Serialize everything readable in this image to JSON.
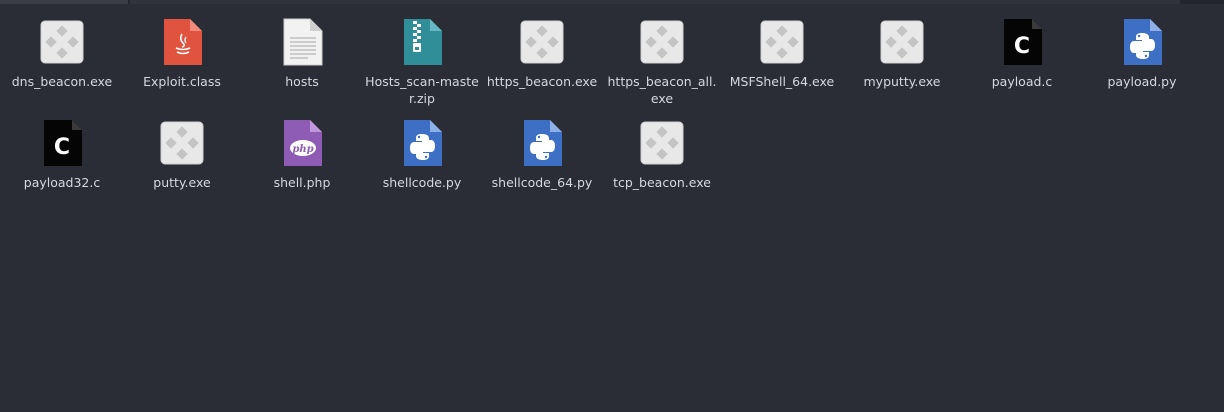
{
  "files": [
    {
      "name": "dns_beacon.exe",
      "icon": "exe-icon"
    },
    {
      "name": "Exploit.class",
      "icon": "java-class-icon"
    },
    {
      "name": "hosts",
      "icon": "text-file-icon"
    },
    {
      "name": "Hosts_scan-master.zip",
      "icon": "zip-archive-icon"
    },
    {
      "name": "https_beacon.exe",
      "icon": "exe-icon"
    },
    {
      "name": "https_beacon_all.exe",
      "icon": "exe-icon"
    },
    {
      "name": "MSFShell_64.exe",
      "icon": "exe-icon"
    },
    {
      "name": "myputty.exe",
      "icon": "exe-icon"
    },
    {
      "name": "payload.c",
      "icon": "c-source-icon"
    },
    {
      "name": "payload.py",
      "icon": "python-file-icon"
    },
    {
      "name": "payload32.c",
      "icon": "c-source-icon"
    },
    {
      "name": "putty.exe",
      "icon": "exe-icon"
    },
    {
      "name": "shell.php",
      "icon": "php-file-icon"
    },
    {
      "name": "shellcode.py",
      "icon": "python-file-icon"
    },
    {
      "name": "shellcode_64.py",
      "icon": "python-file-icon"
    },
    {
      "name": "tcp_beacon.exe",
      "icon": "exe-icon"
    }
  ],
  "colors": {
    "background": "#2a2c36",
    "label": "#d6d8de",
    "java": "#e0533f",
    "zip": "#2f8e98",
    "python": "#3d6fc4",
    "php": "#8e5cb5",
    "exe_bg": "#e8e8e8"
  }
}
